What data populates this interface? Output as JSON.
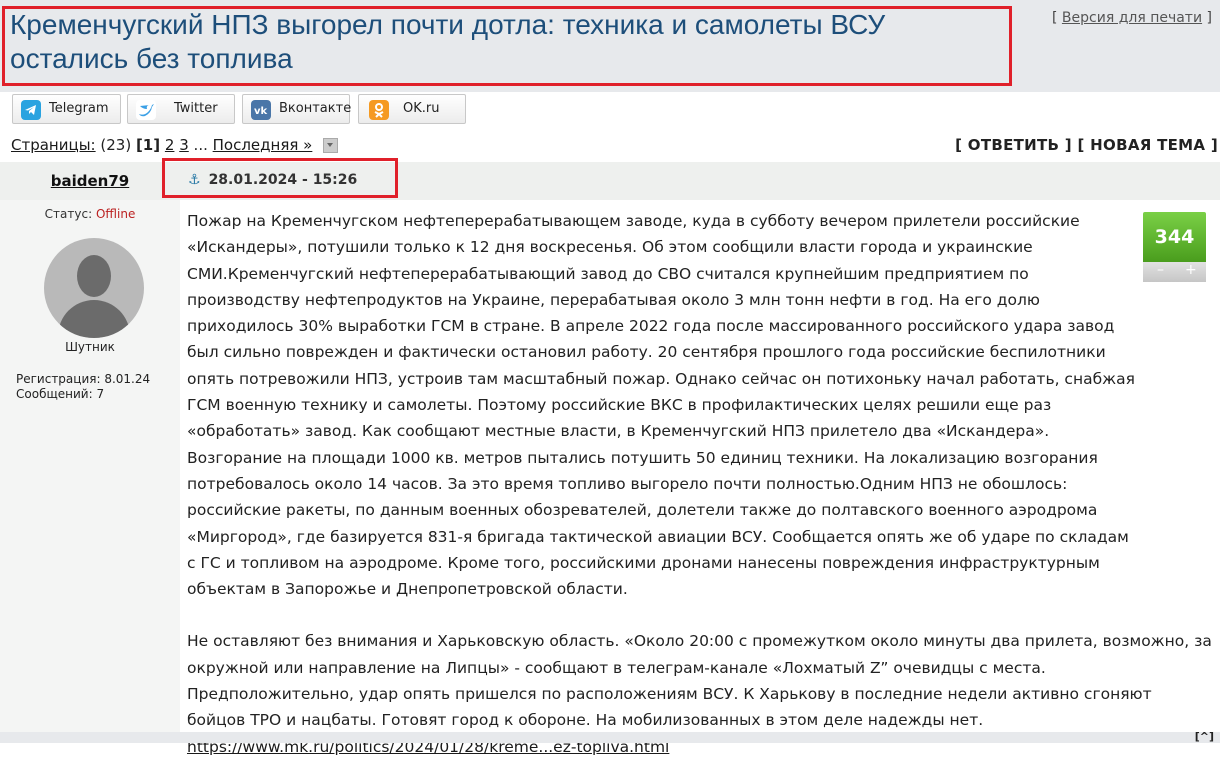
{
  "header": {
    "title": "Кременчугский НПЗ выгорел почти дотла: техника и самолеты ВСУ остались без топлива",
    "print_version": "Версия для печати",
    "print_open": "[",
    "print_close": "]"
  },
  "share": {
    "buttons": [
      {
        "label": "Telegram",
        "icon": "telegram-icon",
        "color": "#2aa3e0"
      },
      {
        "label": "Twitter",
        "icon": "twitter-icon",
        "color": "#3ba0e6"
      },
      {
        "label": "Вконтакте",
        "icon": "vk-icon",
        "color": "#4a76a8"
      },
      {
        "label": "OK.ru",
        "icon": "ok-icon",
        "color": "#f59a22"
      }
    ]
  },
  "pagination": {
    "pages_label": "Страницы:",
    "count": "(23)",
    "current": "[1]",
    "page2": "2",
    "page3": "3",
    "ellipsis": "...",
    "last": "Последняя »",
    "reply": "[ ОТВЕТИТЬ ]",
    "new_topic": "[ НОВАЯ ТЕМА ]"
  },
  "post": {
    "author": "baiden79",
    "date": "28.01.2024 - 15:26",
    "status_label": "Статус:",
    "status_value": "Offline",
    "rank": "Шутник",
    "registration": "Регистрация: 8.01.24",
    "messages": "Сообщений: 7",
    "rating": "344",
    "rating_minus": "–",
    "rating_plus": "+",
    "paragraph1": "Пожар на Кременчугском нефтеперерабатывающем заводе, куда в субботу вечером прилетели российские «Искандеры», потушили только к 12 дня воскресенья. Об этом сообщили власти города и украинские СМИ.Кременчугский нефтеперерабатывающий завод до СВО считался крупнейшим предприятием по производству нефтепродуктов на Украине, перерабатывая около 3 млн тонн нефти в год. На его долю приходилось 30% выработки ГСМ в стране. В апреле 2022 года после массированного российского удара завод был сильно поврежден и фактически остановил работу. 20 сентября прошлого года российские беспилотники опять потревожили НПЗ, устроив там масштабный пожар. Однако сейчас он потихоньку начал работать, снабжая ГСМ военную технику и самолеты. Поэтому российские ВКС в профилактических целях решили еще раз «обработать» завод. Как сообщают местные власти, в Кременчугский НПЗ прилетело два «Искандера». Возгорание на площади 1000 кв. метров пытались потушить 50 единиц техники. На локализацию возгорания потребовалось около 14 часов. За это время топливо выгорело почти полностью.Одним НПЗ не обошлось: российские ракеты, по данным военных обозревателей, долетели также до полтавского военного аэродрома «Миргород», где базируется 831-я бригада тактической авиации ВСУ. Сообщается опять же об ударе по складам с ГС и топливом на аэродроме. Кроме того, российскими дронами нанесены повреждения инфраструктурным объектам в Запорожье и Днепропетровской области.",
    "paragraph2": "Не оставляют без внимания и Харьковскую область. «Около 20:00 с промежутком около минуты два прилета, возможно, за окружной или направление на Липцы» - сообщают в телеграм-канале «Лохматый Z” очевидцы с места. Предположительно, удар опять пришелся по расположениям ВСУ. К Харькову в последние недели активно сгоняют бойцов ТРО и нацбаты. Готовят город к обороне. На мобилизованных в этом деле надежды нет.",
    "link": "https://www.mk.ru/politics/2024/01/28/kreme...ez-topliva.html",
    "top_link": "[^]"
  },
  "colors": {
    "highlight": "#e0202a",
    "title": "#1d4e7a",
    "rating_green": "#5bb52c"
  }
}
